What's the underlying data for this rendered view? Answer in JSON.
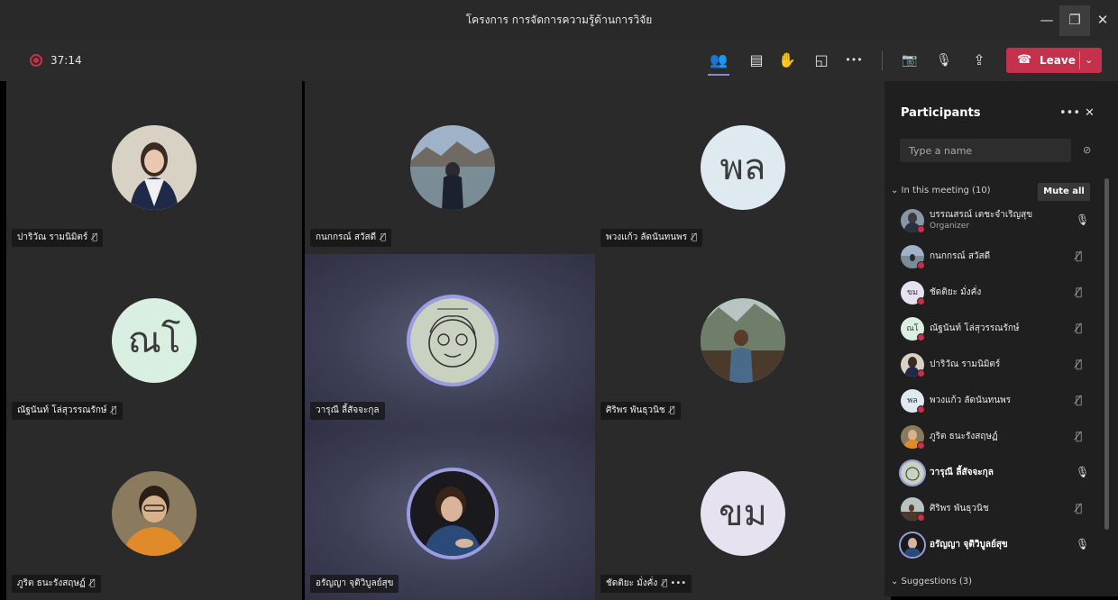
{
  "window": {
    "title": "โครงการ การจัดการความรู้ด้านการวิจัย",
    "minimize": "—",
    "maximize": "❐",
    "close": "✕"
  },
  "toolbar": {
    "timer": "37:14",
    "icons": {
      "people": "👥",
      "chat": "▤",
      "raise_hand": "✋",
      "rooms": "◱",
      "more": "•••",
      "camera": "📷",
      "mic": "🎙",
      "share": "⇪"
    },
    "leave_icon": "☎",
    "leave_label": "Leave",
    "leave_caret": "⌄"
  },
  "colors": {
    "accent": "#8b8cc7",
    "leave": "#c4314b",
    "background": "#2a2a2a",
    "panel": "#1f1f1f"
  },
  "tiles": [
    {
      "name": "ปาริวัณ รามนิมิตร์",
      "mic": "🎙̸",
      "avatar": "photo-woman"
    },
    {
      "name": "กนกกรณ์ สวัสดี",
      "mic": "🎙̸",
      "avatar": "photo-landscape"
    },
    {
      "name": "พวงแก้ว ลัดนันทนพร",
      "mic": "🎙̸",
      "initials": "พล",
      "color": "#dfe9f0"
    },
    {
      "name": "ณัฐนันท์ โล่สุวรรณรักษ์",
      "mic": "🎙̸",
      "initials": "ณโ",
      "color": "#d9efe1"
    },
    {
      "name": "วารุณี ลี้สัจจะกุล",
      "mic": "",
      "avatar": "sketch"
    },
    {
      "name": "ศิริพร พันธุวนิช",
      "mic": "🎙̸",
      "avatar": "photo-mountain"
    },
    {
      "name": "ภูริต ธนะรังสฤษฏ์",
      "mic": "🎙̸",
      "avatar": "photo-man"
    },
    {
      "name": "อรัญญา จุติวิบูลย์สุข",
      "mic": "",
      "avatar": "photo-woman2"
    },
    {
      "name": "ชัดติยะ มั่งคั่ง",
      "mic": "🎙̸  •••",
      "initials": "ขม",
      "color": "#e6e2f0"
    }
  ],
  "panel": {
    "title": "Participants",
    "more": "•••",
    "close": "✕",
    "search_placeholder": "Type a name",
    "link_icon": "⊘",
    "section": "⌄ In this meeting (10)",
    "mute_all": "Mute all",
    "suggestions": "⌄ Suggestions (3)",
    "people": [
      {
        "name": "บรรณสรณ์ เตชะจำเริญสุข",
        "role": "Organizer",
        "mic": "🎙",
        "initials": ""
      },
      {
        "name": "กนกกรณ์ สวัสดี",
        "mic": "🎙̸",
        "initials": ""
      },
      {
        "name": "ชัดติยะ มั่งคั่ง",
        "mic": "🎙̸",
        "initials": "ขม"
      },
      {
        "name": "ณัฐนันท์ โล่สุวรรณรักษ์",
        "mic": "🎙̸",
        "initials": "ณโ"
      },
      {
        "name": "ปาริวัณ รามนิมิตร์",
        "mic": "🎙̸",
        "initials": ""
      },
      {
        "name": "พวงแก้ว ลัดนันทนพร",
        "mic": "🎙̸",
        "initials": "พล"
      },
      {
        "name": "ภูริต ธนะรังสฤษฏ์",
        "mic": "🎙̸",
        "initials": ""
      },
      {
        "name": "วารุณี ลี้สัจจะกุล",
        "mic": "🎙",
        "initials": ""
      },
      {
        "name": "ศิริพร พันธุวนิช",
        "mic": "🎙̸",
        "initials": ""
      },
      {
        "name": "อรัญญา จุติวิบูลย์สุข",
        "mic": "🎙",
        "initials": ""
      }
    ]
  }
}
